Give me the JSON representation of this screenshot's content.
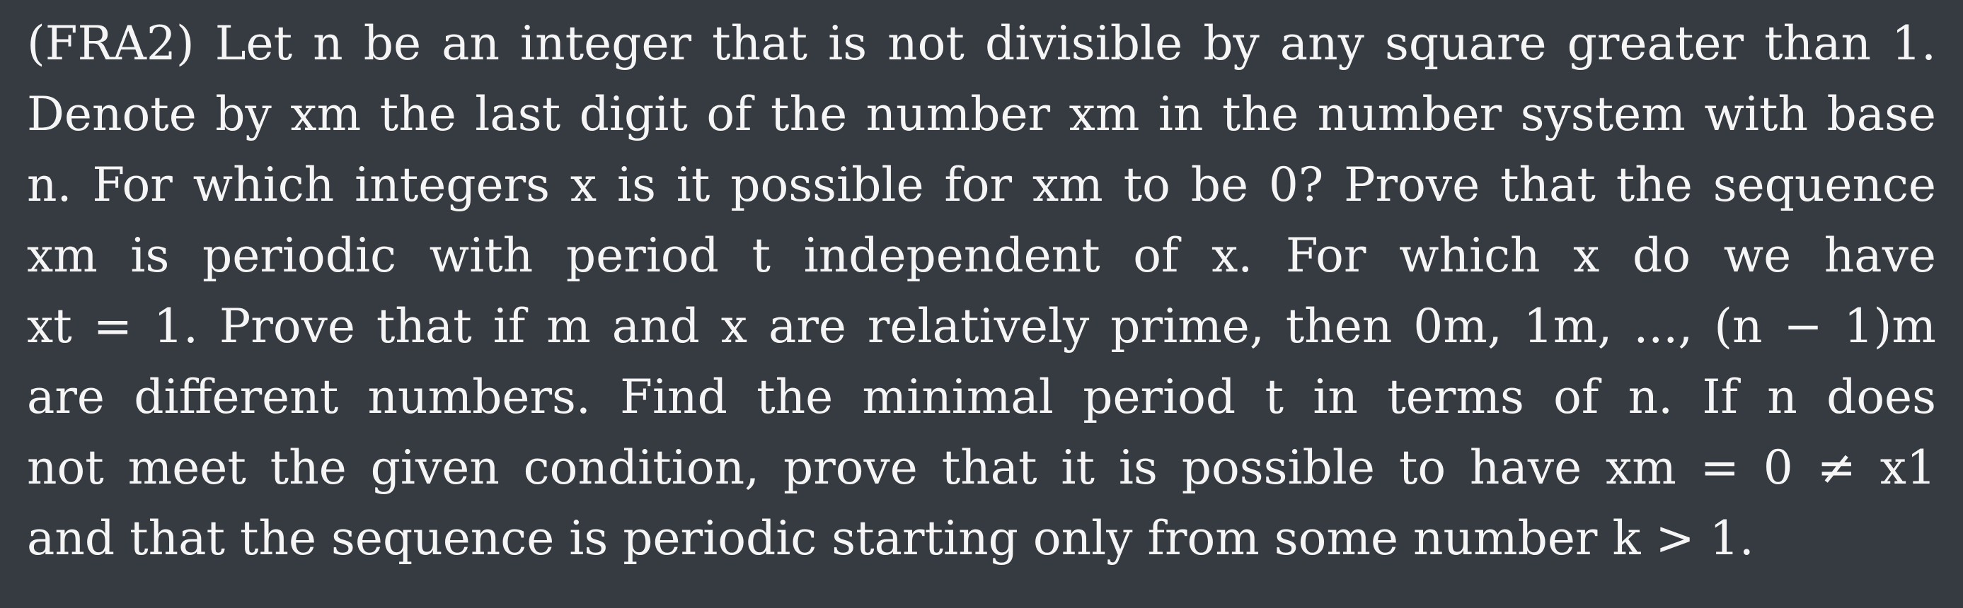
{
  "problem": {
    "lines": [
      "(FRA2) Let n be an integer that is not divisible by any square greater than 1.",
      "Denote by xm the last digit of the number xm in the number system with base",
      "n. For which integers x is it possible for xm to be 0? Prove that the sequence",
      "xm is periodic with period t independent of x. For which x do we have",
      "xt = 1. Prove that if m and x are relatively prime, then 0m, 1m, ..., (n − 1)m",
      "are different numbers. Find the minimal period t in terms of n. If n does",
      "not meet the given condition, prove that it is possible to have xm = 0 ≠ x1",
      "and that the sequence is periodic starting only from some number k > 1."
    ]
  }
}
